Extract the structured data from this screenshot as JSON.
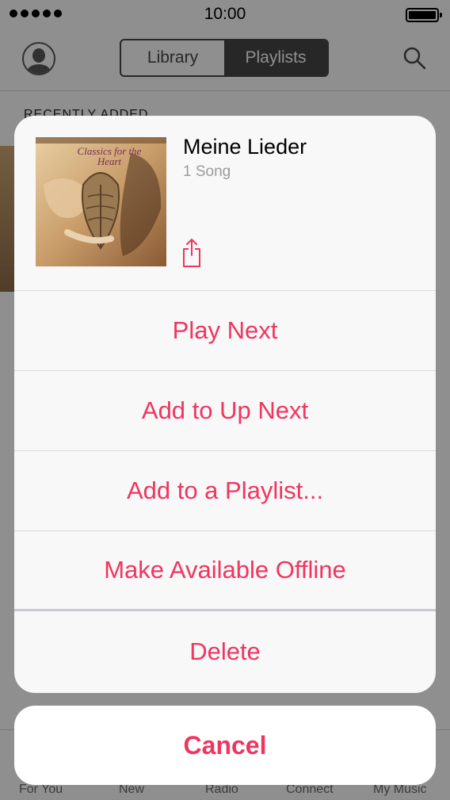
{
  "status_bar": {
    "time": "10:00"
  },
  "nav": {
    "segments": [
      {
        "label": "Library",
        "active": false
      },
      {
        "label": "Playlists",
        "active": true
      }
    ]
  },
  "background": {
    "section_header": "RECENTLY ADDED"
  },
  "tab_bar": {
    "items": [
      {
        "label": "For You"
      },
      {
        "label": "New"
      },
      {
        "label": "Radio"
      },
      {
        "label": "Connect"
      },
      {
        "label": "My Music"
      }
    ]
  },
  "sheet": {
    "artwork_text": "Classics for the Heart",
    "title": "Meine Lieder",
    "subtitle": "1 Song",
    "actions": [
      {
        "label": "Play Next"
      },
      {
        "label": "Add to Up Next"
      },
      {
        "label": "Add to a Playlist..."
      },
      {
        "label": "Make Available Offline"
      },
      {
        "label": "Delete"
      }
    ],
    "cancel_label": "Cancel"
  },
  "colors": {
    "accent": "#f0355f"
  }
}
